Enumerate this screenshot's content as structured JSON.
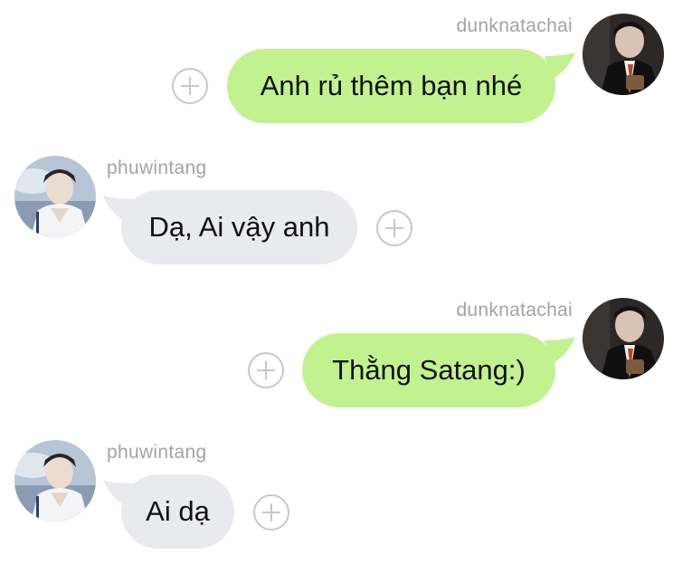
{
  "colors": {
    "outgoing_bubble": "#c2f28f",
    "incoming_bubble": "#e8eaed",
    "username": "#a3a3a3",
    "plus_button": "#c8c8c8"
  },
  "messages": [
    {
      "direction": "outgoing",
      "username": "dunknatachai",
      "text": "Anh rủ thêm bạn nhé",
      "avatar_icon": "avatar-dunknatachai",
      "action_icon": "add-circle-icon"
    },
    {
      "direction": "incoming",
      "username": "phuwintang",
      "text": "Dạ, Ai vậy anh",
      "avatar_icon": "avatar-phuwintang",
      "action_icon": "add-circle-icon"
    },
    {
      "direction": "outgoing",
      "username": "dunknatachai",
      "text": "Thằng Satang:)",
      "avatar_icon": "avatar-dunknatachai",
      "action_icon": "add-circle-icon"
    },
    {
      "direction": "incoming",
      "username": "phuwintang",
      "text": "Ai dạ",
      "avatar_icon": "avatar-phuwintang",
      "action_icon": "add-circle-icon"
    }
  ]
}
